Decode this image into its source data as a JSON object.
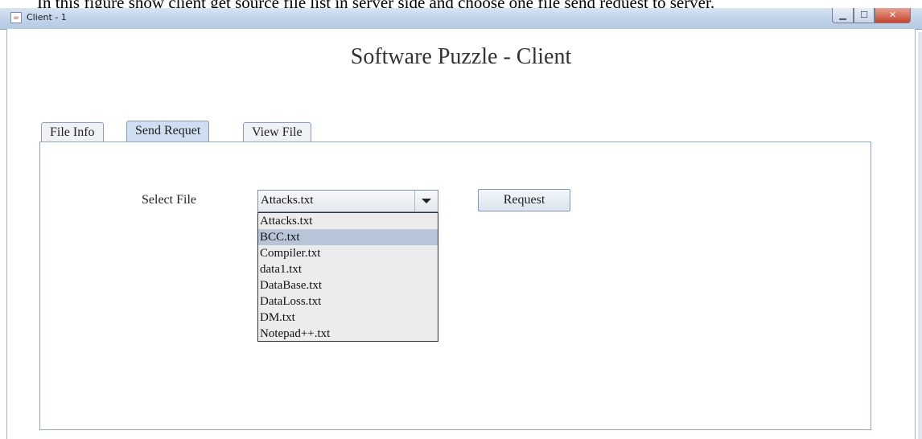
{
  "caption": "In this figure show client get source file list in server side and choose one file send request to server.",
  "window": {
    "title": "Client - 1",
    "icon": "java-cup-icon",
    "controls": {
      "minimize": "▁",
      "maximize": "☐",
      "close": "✕"
    }
  },
  "app": {
    "heading": "Software Puzzle - Client"
  },
  "tabs": [
    {
      "label": "File Info",
      "selected": false
    },
    {
      "label": "Send Requet",
      "selected": true
    },
    {
      "label": "View File",
      "selected": false
    }
  ],
  "form": {
    "select_label": "Select File",
    "selected_value": "Attacks.txt",
    "options": [
      "Attacks.txt",
      "BCC.txt",
      "Compiler.txt",
      "data1.txt",
      "DataBase.txt",
      "DataLoss.txt",
      "DM.txt",
      "Notepad++.txt"
    ],
    "highlighted_option": "BCC.txt",
    "request_label": "Request"
  },
  "colors": {
    "titlebar": "#c2d4ea",
    "selected_tab": "#cfdff1",
    "highlight": "#b6c6d8"
  }
}
